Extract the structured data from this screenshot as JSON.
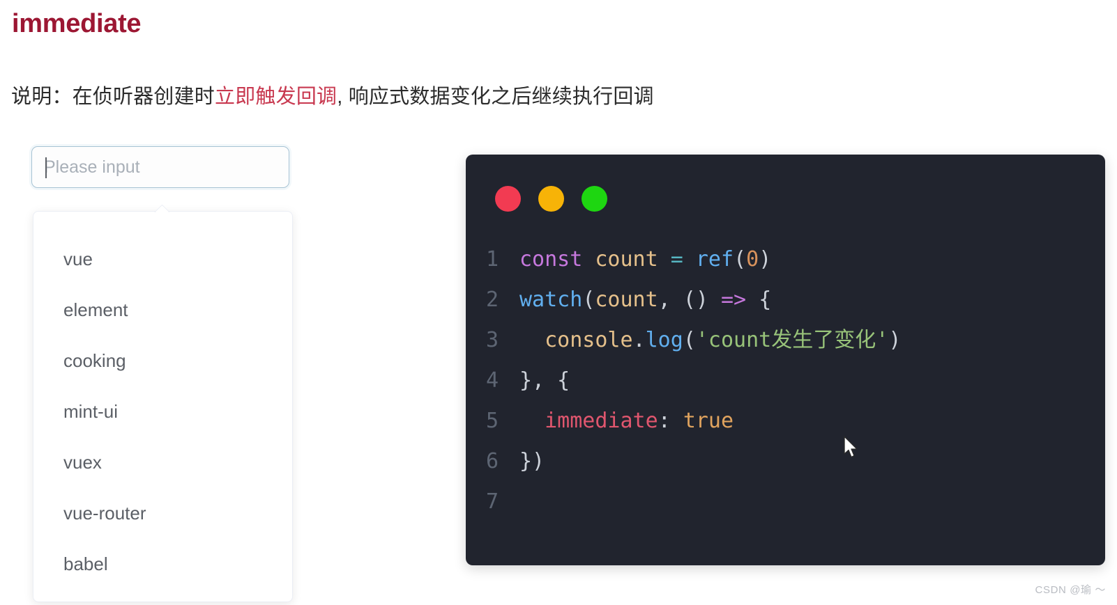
{
  "page": {
    "title": "immediate",
    "title_color": "#9c1733",
    "description_prefix": "说明：在侦听器创建时",
    "description_highlight": "立即触发回调",
    "description_suffix": ", 响应式数据变化之后继续执行回调",
    "highlight_color": "#c8384f"
  },
  "autocomplete": {
    "placeholder": "Please input",
    "value": "",
    "border_color": "#a7c3d4",
    "items": [
      {
        "label": "vue"
      },
      {
        "label": "element"
      },
      {
        "label": "cooking"
      },
      {
        "label": "mint-ui"
      },
      {
        "label": "vuex"
      },
      {
        "label": "vue-router"
      },
      {
        "label": "babel"
      }
    ]
  },
  "code_card": {
    "background": "#21242e",
    "window_dots": [
      {
        "name": "close-dot",
        "color": "#f23b52"
      },
      {
        "name": "minimize-dot",
        "color": "#f7b307"
      },
      {
        "name": "maximize-dot",
        "color": "#1ed611"
      }
    ],
    "line_numbers": [
      "1",
      "2",
      "3",
      "4",
      "5",
      "6",
      "7"
    ],
    "lines": [
      {
        "n": "1",
        "raw": "const count = ref(0)"
      },
      {
        "n": "2",
        "raw": "watch(count, () => {"
      },
      {
        "n": "3",
        "raw": "  console.log('count发生了变化')"
      },
      {
        "n": "4",
        "raw": "}, {"
      },
      {
        "n": "5",
        "raw": "  immediate: true"
      },
      {
        "n": "6",
        "raw": "})"
      },
      {
        "n": "7",
        "raw": ""
      }
    ],
    "tokens": {
      "l1_kw": "const",
      "l1_sp1": " ",
      "l1_var": "count",
      "l1_sp2": " ",
      "l1_op": "=",
      "l1_sp3": " ",
      "l1_fn": "ref",
      "l1_p1": "(",
      "l1_num": "0",
      "l1_p2": ")",
      "l2_fn": "watch",
      "l2_p1": "(",
      "l2_var": "count",
      "l2_c": ", ",
      "l2_p2": "()",
      "l2_sp": " ",
      "l2_arrow": "=>",
      "l2_sp2": " ",
      "l2_brace": "{",
      "l3_indent": "  ",
      "l3_obj": "console",
      "l3_dot": ".",
      "l3_fn": "log",
      "l3_p1": "(",
      "l3_str": "'count发生了变化'",
      "l3_p2": ")",
      "l4_txt": "}, {",
      "l5_indent": "  ",
      "l5_prop": "immediate",
      "l5_colon": ": ",
      "l5_bool": "true",
      "l6_txt": "})",
      "l7_txt": ""
    }
  },
  "watermark": {
    "text": "CSDN @瑜 ～"
  }
}
